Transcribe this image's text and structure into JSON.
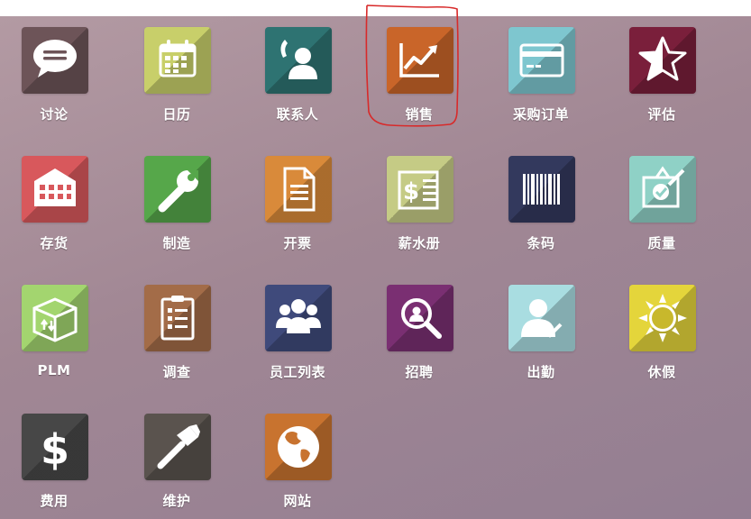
{
  "apps": [
    {
      "label": "讨论",
      "icon": "chat-bubble-icon",
      "color": "#6d5458"
    },
    {
      "label": "日历",
      "icon": "calendar-icon",
      "color": "#c8cf6a"
    },
    {
      "label": "联系人",
      "icon": "contacts-icon",
      "color": "#2e7372"
    },
    {
      "label": "销售",
      "icon": "sales-chart-icon",
      "color": "#c96529"
    },
    {
      "label": "采购订单",
      "icon": "credit-card-icon",
      "color": "#7ec6cf"
    },
    {
      "label": "评估",
      "icon": "star-icon",
      "color": "#7a1f3b"
    },
    {
      "label": "存货",
      "icon": "warehouse-icon",
      "color": "#d8585c"
    },
    {
      "label": "制造",
      "icon": "wrench-icon",
      "color": "#56a74a"
    },
    {
      "label": "开票",
      "icon": "invoice-document-icon",
      "color": "#d98a3a"
    },
    {
      "label": "薪水册",
      "icon": "payroll-dollar-sheet-icon",
      "color": "#c5cb85"
    },
    {
      "label": "条码",
      "icon": "barcode-icon",
      "color": "#33395d"
    },
    {
      "label": "质量",
      "icon": "quality-check-icon",
      "color": "#8fd1c6"
    },
    {
      "label": "PLM",
      "icon": "box-arrows-icon",
      "color": "#a3d56f"
    },
    {
      "label": "调查",
      "icon": "survey-clipboard-icon",
      "color": "#a36c48"
    },
    {
      "label": "员工列表",
      "icon": "employees-group-icon",
      "color": "#3f4a7b"
    },
    {
      "label": "招聘",
      "icon": "recruitment-magnifier-icon",
      "color": "#7a2f72"
    },
    {
      "label": "出勤",
      "icon": "attendance-user-check-icon",
      "color": "#a9dde1"
    },
    {
      "label": "休假",
      "icon": "sun-icon",
      "color": "#e4d53b"
    },
    {
      "label": "费用",
      "icon": "dollar-icon",
      "color": "#474747"
    },
    {
      "label": "维护",
      "icon": "hammer-icon",
      "color": "#5a534e"
    },
    {
      "label": "网站",
      "icon": "globe-icon",
      "color": "#c8732f"
    }
  ],
  "highlight_color": "#d82a2a"
}
